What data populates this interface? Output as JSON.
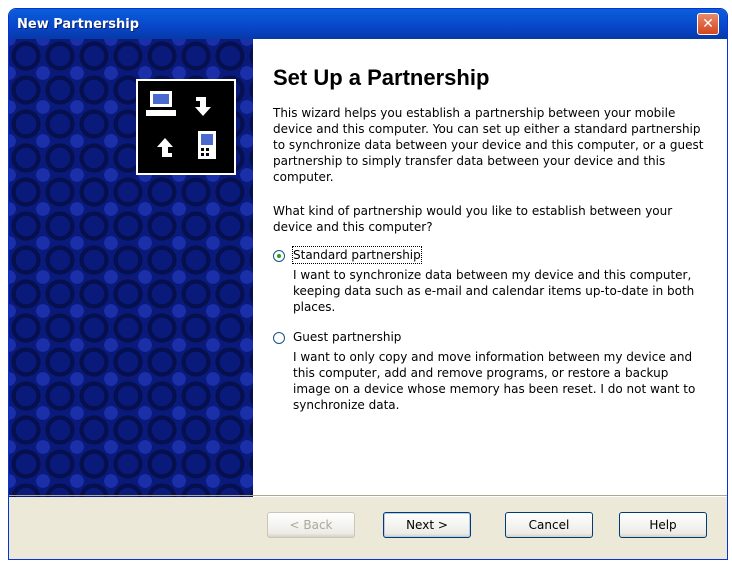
{
  "window": {
    "title": "New Partnership",
    "close_glyph": "✕"
  },
  "main": {
    "heading": "Set Up a Partnership",
    "intro": "This wizard helps you establish a partnership between your mobile device and this computer. You can set up either a standard partnership to synchronize data between your device and this computer, or a guest partnership to simply transfer data between your device and this computer.",
    "question": "What kind of partnership would you like to establish between your device and this computer?",
    "options": [
      {
        "label": "Standard partnership",
        "selected": true,
        "desc": "I want to synchronize data between my device and this computer, keeping data such as e-mail and calendar items up-to-date in both places."
      },
      {
        "label": "Guest partnership",
        "selected": false,
        "desc": "I want to only copy and move information between my device and this computer, add and remove programs, or restore a backup image on a device whose memory has been reset. I do not want to synchronize data."
      }
    ]
  },
  "buttons": {
    "back": "< Back",
    "next": "Next >",
    "cancel": "Cancel",
    "help": "Help"
  },
  "icons": {
    "sidebar_logo": "sync-devices-icon"
  },
  "colors": {
    "title_bar": "#0846c9",
    "sidebar": "#0a1a7a",
    "dialog_bg": "#ece9d8"
  }
}
